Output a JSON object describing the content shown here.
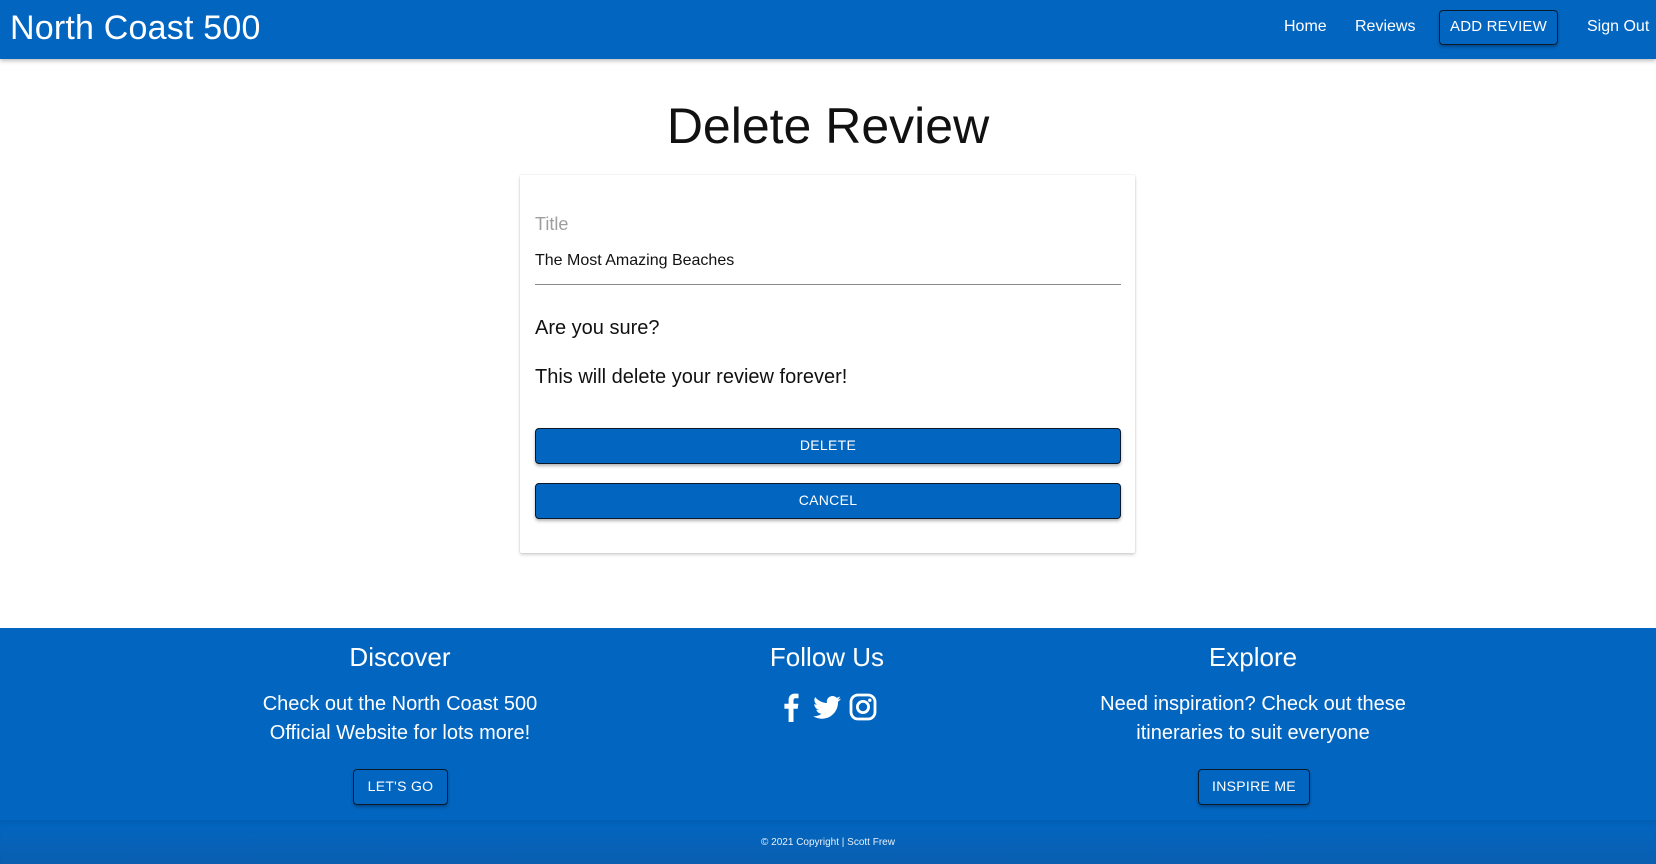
{
  "navbar": {
    "brand": "North Coast 500",
    "links": {
      "home": "Home",
      "reviews": "Reviews",
      "add_review": "ADD REVIEW",
      "sign_out": "Sign Out"
    }
  },
  "main": {
    "page_title": "Delete Review",
    "form": {
      "title_label": "Title",
      "title_value": "The Most Amazing Beaches",
      "confirm_question": "Are you sure?",
      "confirm_warning": "This will delete your review forever!",
      "delete_label": "DELETE",
      "cancel_label": "CANCEL"
    }
  },
  "footer": {
    "discover": {
      "heading": "Discover",
      "text": "Check out the North Coast 500 Official Website for lots more!",
      "button": "LET'S GO"
    },
    "follow": {
      "heading": "Follow Us",
      "icons": [
        "facebook-icon",
        "twitter-icon",
        "instagram-icon"
      ]
    },
    "explore": {
      "heading": "Explore",
      "text": "Need inspiration? Check out these itineraries to suit everyone",
      "button": "INSPIRE ME"
    },
    "copyright": "© 2021 Copyright | Scott Frew"
  },
  "colors": {
    "primary": "#0266c1",
    "button_border": "#0a1a2a",
    "label_grey": "#9e9e9e"
  }
}
